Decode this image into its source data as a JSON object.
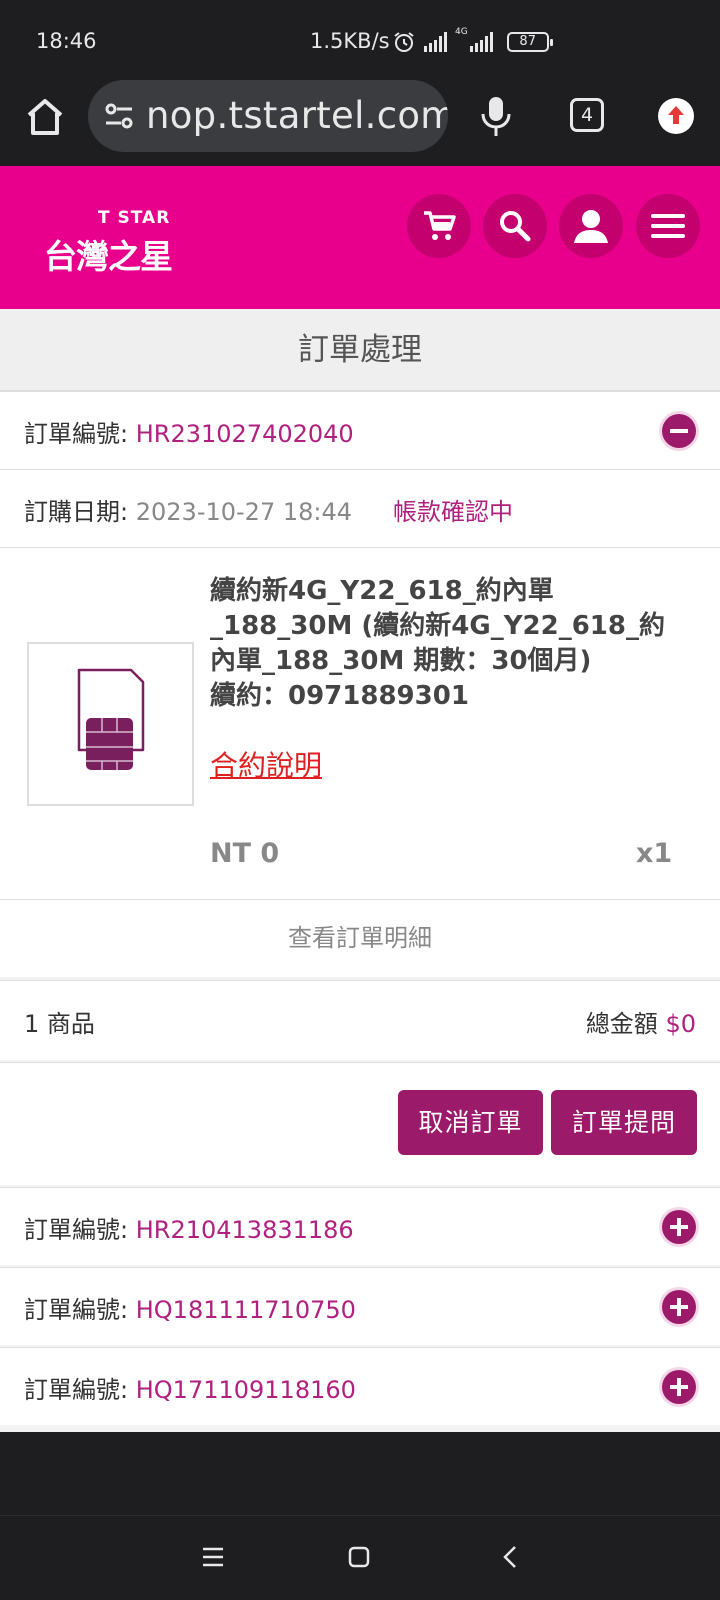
{
  "status_bar": {
    "time": "18:46",
    "net_speed": "1.5KB/s",
    "network_type": "4G",
    "battery": "87",
    "icons": [
      "alarm-icon",
      "signal-icon",
      "signal-4g-icon",
      "battery-icon"
    ]
  },
  "browser": {
    "url": "nop.tstartel.com",
    "tab_count": "4",
    "icons": [
      "home-icon",
      "site-settings-icon",
      "mic-icon",
      "tabs-icon",
      "update-icon"
    ]
  },
  "header": {
    "logo_en": "T STAR",
    "logo_zh": "台灣之星",
    "brand_color": "#e8008c",
    "icons": [
      "cart-icon",
      "search-icon",
      "user-icon",
      "menu-icon"
    ]
  },
  "page": {
    "title": "訂單處理"
  },
  "current_order": {
    "number_label": "訂單編號:",
    "number": "HR231027402040",
    "date_label": "訂購日期:",
    "date": "2023-10-27 18:44",
    "status": "帳款確認中",
    "product": {
      "name": "續約新4G_Y22_618_約內單_188_30M (續約新4G_Y22_618_約內單_188_30M 期數：30個月)",
      "renewal": "續約：0971889301",
      "contract_link": "合約說明",
      "price": "NT 0",
      "qty": "x1"
    },
    "view_detail": "查看訂單明細",
    "items_count": "1 商品",
    "total_label": "總金額",
    "total_value": "$0",
    "buttons": {
      "cancel": "取消訂單",
      "question": "訂單提問"
    }
  },
  "other_orders": [
    {
      "label": "訂單編號:",
      "number": "HR210413831186"
    },
    {
      "label": "訂單編號:",
      "number": "HQ181111710750"
    },
    {
      "label": "訂單編號:",
      "number": "HQ171109118160"
    }
  ],
  "accent_color": "#9c1a6a"
}
